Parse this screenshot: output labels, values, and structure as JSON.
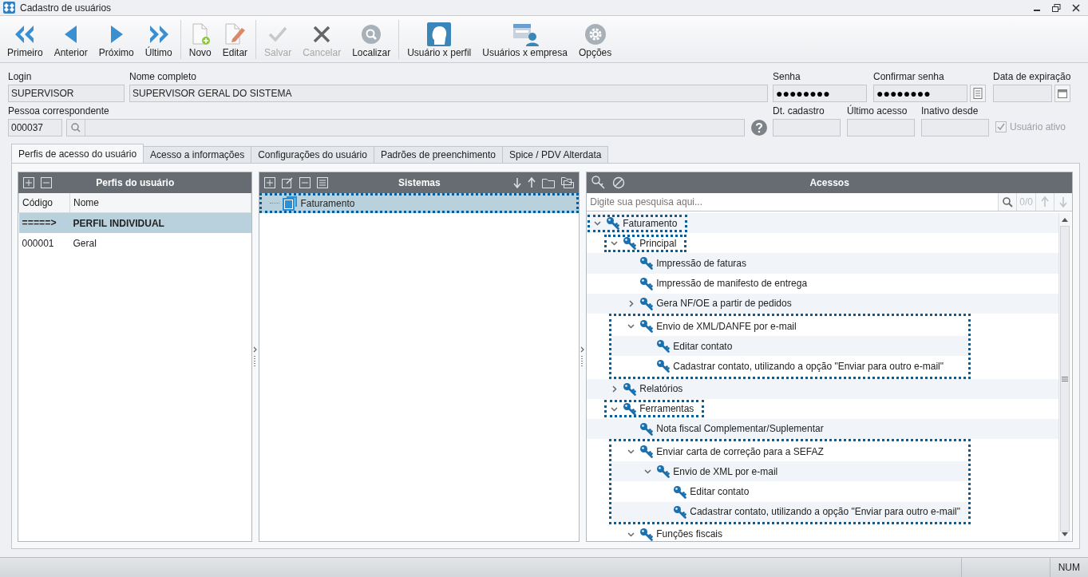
{
  "window": {
    "title": "Cadastro de usuários"
  },
  "toolbar": [
    {
      "label": "Primeiro",
      "kind": "first",
      "disabled": false,
      "separator_after": false
    },
    {
      "label": "Anterior",
      "kind": "prev",
      "disabled": false,
      "separator_after": false
    },
    {
      "label": "Próximo",
      "kind": "next",
      "disabled": false,
      "separator_after": false
    },
    {
      "label": "Último",
      "kind": "last",
      "disabled": false,
      "separator_after": true
    },
    {
      "label": "Novo",
      "kind": "new",
      "disabled": false,
      "separator_after": false
    },
    {
      "label": "Editar",
      "kind": "edit",
      "disabled": false,
      "separator_after": true
    },
    {
      "label": "Salvar",
      "kind": "save",
      "disabled": true,
      "separator_after": false
    },
    {
      "label": "Cancelar",
      "kind": "cancel",
      "disabled": true,
      "separator_after": false
    },
    {
      "label": "Localizar",
      "kind": "find",
      "disabled": false,
      "separator_after": true
    },
    {
      "label": "Usuário x perfil",
      "kind": "profile",
      "disabled": false,
      "separator_after": false
    },
    {
      "label": "Usuários x empresa",
      "kind": "company",
      "disabled": false,
      "separator_after": false
    },
    {
      "label": "Opções",
      "kind": "options",
      "disabled": false,
      "separator_after": false
    }
  ],
  "form": {
    "login": {
      "label": "Login",
      "value": "SUPERVISOR"
    },
    "full_name": {
      "label": "Nome completo",
      "value": "SUPERVISOR GERAL DO SISTEMA"
    },
    "password": {
      "label": "Senha",
      "value": "●●●●●●●●"
    },
    "confirm_password": {
      "label": "Confirmar senha",
      "value": "●●●●●●●●"
    },
    "expiration_date": {
      "label": "Data de expiração"
    },
    "person": {
      "label": "Pessoa correspondente",
      "code": "000037"
    },
    "registered": {
      "label": "Dt. cadastro"
    },
    "last_access": {
      "label": "Último acesso"
    },
    "inactive_since": {
      "label": "Inativo desde"
    },
    "active": {
      "label": "Usuário ativo",
      "checked": true,
      "disabled": true
    }
  },
  "tabs": [
    {
      "label": "Perfis de acesso do usuário",
      "selected": true
    },
    {
      "label": "Acesso a informações",
      "selected": false
    },
    {
      "label": "Configurações do usuário",
      "selected": false
    },
    {
      "label": "Padrões de preenchimento",
      "selected": false
    },
    {
      "label": "Spice / PDV Alterdata",
      "selected": false
    }
  ],
  "profiles": {
    "title": "Perfis do usuário",
    "columns": [
      "Código",
      "Nome"
    ],
    "rows": [
      {
        "code": "=====>",
        "name": "PERFIL INDIVIDUAL",
        "selected": true
      },
      {
        "code": "000001",
        "name": "Geral",
        "selected": false
      }
    ]
  },
  "systems": {
    "title": "Sistemas",
    "items": [
      {
        "label": "Faturamento",
        "selected": true
      }
    ]
  },
  "access": {
    "title": "Acessos",
    "search": {
      "placeholder": "Digite sua pesquisa aqui...",
      "count": "0/0"
    },
    "tree": [
      {
        "label": "Faturamento",
        "expanded": true,
        "outlined": true,
        "outline_children": false,
        "children": [
          {
            "label": "Principal",
            "expanded": true,
            "outlined": true,
            "outline_children": false,
            "children": [
              {
                "label": "Impressão de faturas",
                "outlined": false
              },
              {
                "label": "Impressão de manifesto de entrega",
                "outlined": false
              },
              {
                "label": "Gera NF/OE a partir de pedidos",
                "expanded": false,
                "outlined": false
              },
              {
                "label": "Envio de XML/DANFE por e-mail",
                "expanded": true,
                "outlined": true,
                "outline_children": true,
                "children": [
                  {
                    "label": "Editar contato",
                    "outlined": false
                  },
                  {
                    "label": "Cadastrar contato, utilizando a opção \"Enviar para outro e-mail\"",
                    "outlined": false
                  }
                ]
              }
            ]
          },
          {
            "label": "Relatórios",
            "expanded": false,
            "outlined": false
          },
          {
            "label": "Ferramentas",
            "expanded": true,
            "outlined": true,
            "outline_children": false,
            "children": [
              {
                "label": "Nota fiscal Complementar/Suplementar",
                "outlined": false
              },
              {
                "label": "Enviar carta de correção para a SEFAZ",
                "expanded": true,
                "outlined": true,
                "outline_children": true,
                "children": [
                  {
                    "label": "Envio de XML por e-mail",
                    "expanded": true,
                    "outlined": false,
                    "children": [
                      {
                        "label": "Editar contato",
                        "outlined": false
                      },
                      {
                        "label": "Cadastrar contato, utilizando a opção \"Enviar para outro e-mail\"",
                        "outlined": false
                      }
                    ]
                  }
                ]
              },
              {
                "label": "Funções fiscais",
                "expanded": true,
                "outlined": false
              }
            ]
          }
        ]
      }
    ]
  },
  "status_bar": {
    "num": "NUM"
  }
}
